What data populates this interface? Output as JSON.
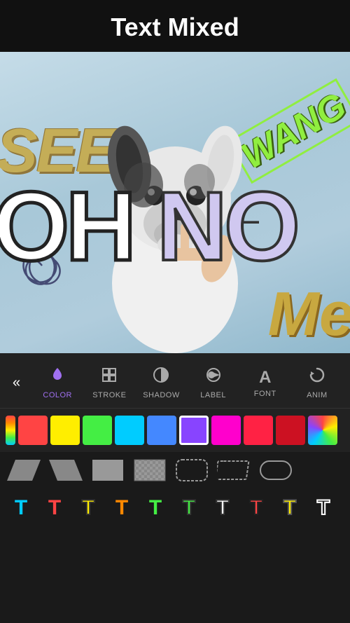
{
  "header": {
    "title": "Text Mixed"
  },
  "canvas": {
    "texts": {
      "see": "SEE",
      "wang": "WANG",
      "oh_no": "OH NO",
      "me": "Me",
      "dash": "—"
    }
  },
  "toolbar": {
    "back_label": "«",
    "tabs": [
      {
        "id": "color",
        "label": "COLOR",
        "icon": "droplet",
        "active": true
      },
      {
        "id": "stroke",
        "label": "STROKE",
        "icon": "grid",
        "active": false
      },
      {
        "id": "shadow",
        "label": "SHADOW",
        "icon": "half-circle",
        "active": false
      },
      {
        "id": "label",
        "label": "LABEL",
        "icon": "tag",
        "active": false
      },
      {
        "id": "font",
        "label": "FONT",
        "icon": "A",
        "active": false
      },
      {
        "id": "anim",
        "label": "ANIM",
        "icon": "refresh",
        "active": false
      }
    ]
  },
  "colors": [
    {
      "id": 1,
      "value": "#ff4444",
      "selected": false
    },
    {
      "id": 2,
      "value": "#ff8800",
      "selected": false
    },
    {
      "id": 3,
      "value": "#ffee00",
      "selected": false
    },
    {
      "id": 4,
      "value": "#44ee44",
      "selected": false
    },
    {
      "id": 5,
      "value": "#00ccff",
      "selected": false
    },
    {
      "id": 6,
      "value": "#8844ff",
      "selected": false
    },
    {
      "id": 7,
      "value": "#cc44ff",
      "selected": true
    },
    {
      "id": 8,
      "value": "#ff0088",
      "selected": false
    },
    {
      "id": 9,
      "value": "#ff2222",
      "selected": false
    },
    {
      "id": 10,
      "value": "#cc2222",
      "selected": false
    },
    {
      "id": 11,
      "value": "#multicolor",
      "selected": false
    }
  ],
  "shapes": [
    {
      "id": 1,
      "type": "parallelogram-left"
    },
    {
      "id": 2,
      "type": "parallelogram-right"
    },
    {
      "id": 3,
      "type": "rectangle"
    },
    {
      "id": 4,
      "type": "checkerboard"
    },
    {
      "id": 5,
      "type": "rounded-rect"
    },
    {
      "id": 6,
      "type": "rounded-parallelogram"
    },
    {
      "id": 7,
      "type": "pill"
    }
  ],
  "font_styles": [
    {
      "id": 1,
      "color": "#00ccff",
      "stroke": "none"
    },
    {
      "id": 2,
      "color": "#ff4444",
      "stroke": "none"
    },
    {
      "id": 3,
      "color": "#ffee00",
      "stroke": "#333"
    },
    {
      "id": 4,
      "color": "#ff8800",
      "stroke": "none"
    },
    {
      "id": 5,
      "color": "#44ee44",
      "stroke": "none"
    },
    {
      "id": 6,
      "color": "#44ee44",
      "stroke": "#333"
    },
    {
      "id": 7,
      "color": "#ffffff",
      "stroke": "#333"
    },
    {
      "id": 8,
      "color": "#ff4444",
      "stroke": "#333"
    },
    {
      "id": 9,
      "color": "#ffee00",
      "stroke": "#444"
    },
    {
      "id": 10,
      "color": "#333333",
      "stroke": "#fff"
    }
  ]
}
